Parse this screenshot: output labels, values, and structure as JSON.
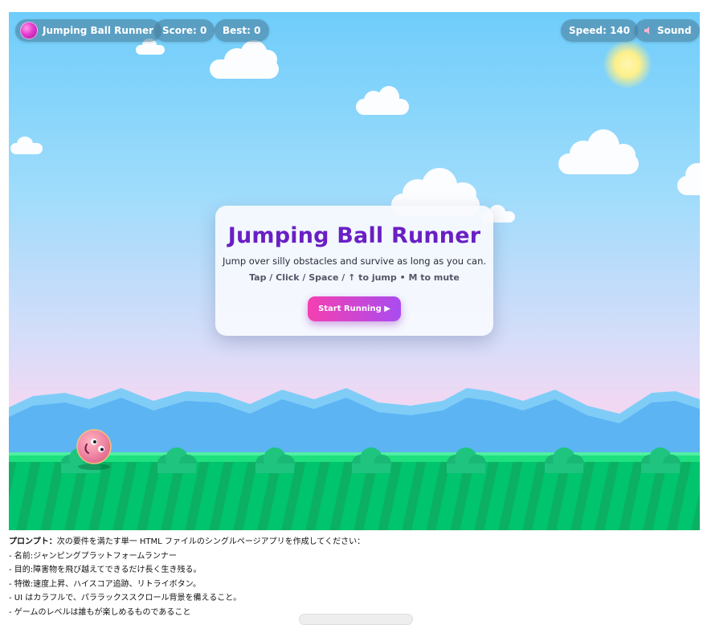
{
  "hud": {
    "title": "Jumping Ball Runner",
    "score": "Score: 0",
    "best": "Best: 0",
    "speed": "Speed: 140",
    "sound": "Sound"
  },
  "start_panel": {
    "title": "Jumping Ball Runner",
    "subtitle": "Jump over silly obstacles and survive as long as you can.",
    "controls": "Tap / Click / Space / ↑ to jump • M to mute",
    "start_button": "Start Running ▶"
  },
  "prompt": {
    "label": "プロンプト：",
    "intro": "次の要件を満たす単一 HTML ファイルのシングルページアプリを作成してください：",
    "lines": [
      "- 名前:ジャンピングプラットフォームランナー",
      "- 目的:障害物を飛び越えてできるだけ長く生き残る。",
      "- 特徴:速度上昇、ハイスコア追跡、リトライボタン。",
      "- UI はカラフルで、パララックススクロール背景を備えること。",
      "- ゲームのレベルは誰もが楽しめるものであること"
    ]
  },
  "colors": {
    "sky_top": "#6fcdfb",
    "mountains": "#4fa9f0",
    "grass": "#00c46e",
    "accent_title": "#6a1fc4",
    "button_gradient": [
      "#f53fb0",
      "#a94cf0"
    ]
  }
}
